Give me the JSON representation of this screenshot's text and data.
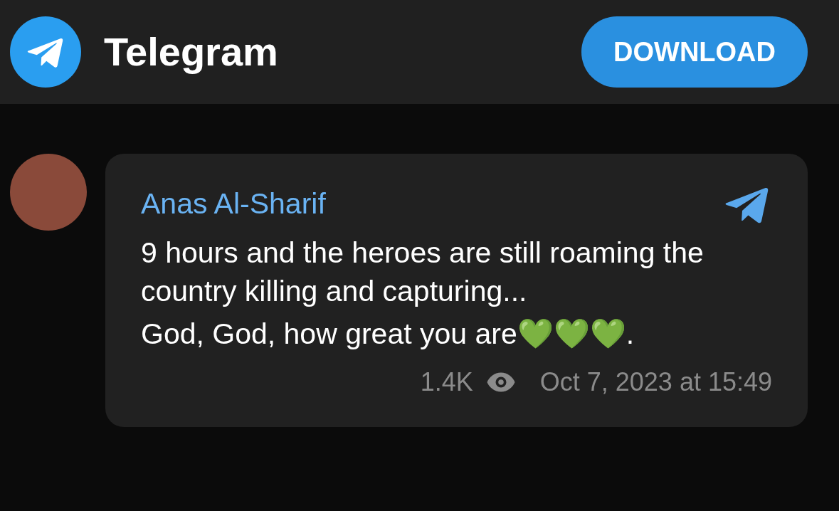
{
  "header": {
    "title": "Telegram",
    "button": "DOWNLOAD"
  },
  "message": {
    "author": "Anas Al-Sharif",
    "paragraphs": [
      "9 hours and the heroes are still roaming the country killing and capturing...",
      "God, God, how great you are💚💚💚."
    ],
    "views": "1.4K",
    "date": "Oct 7, 2023 at 15:49"
  }
}
